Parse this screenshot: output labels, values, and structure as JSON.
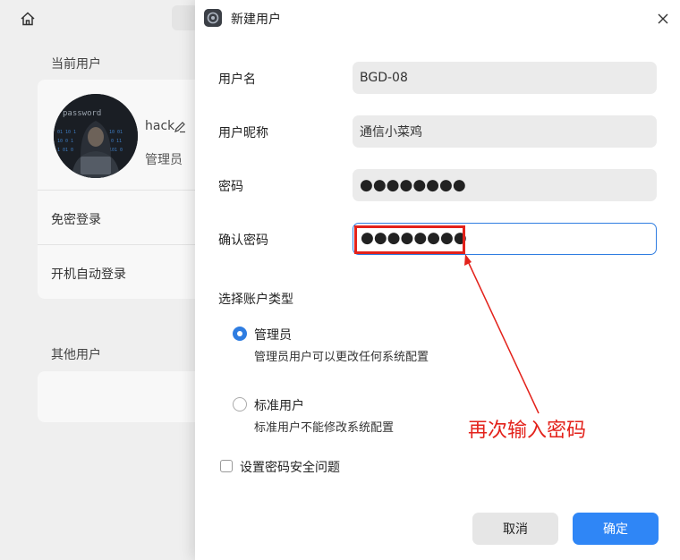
{
  "background": {
    "current_users_label": "当前用户",
    "user": {
      "name": "hack",
      "role": "管理员"
    },
    "rows": [
      "免密登录",
      "开机自动登录"
    ],
    "other_users_label": "其他用户"
  },
  "dialog": {
    "title": "新建用户",
    "fields": [
      {
        "label": "用户名",
        "value": "BGD-08"
      },
      {
        "label": "用户昵称",
        "value": "通信小菜鸡"
      },
      {
        "label": "密码",
        "value": "●●●●●●●●"
      },
      {
        "label": "确认密码",
        "value": "●●●●●●●●"
      }
    ],
    "account_type_title": "选择账户类型",
    "account_types": [
      {
        "title": "管理员",
        "desc": "管理员用户可以更改任何系统配置",
        "selected": true
      },
      {
        "title": "标准用户",
        "desc": "标准用户不能修改系统配置",
        "selected": false
      }
    ],
    "security_question_label": "设置密码安全问题",
    "security_question_checked": false,
    "cancel_label": "取消",
    "ok_label": "确定"
  },
  "annotation": {
    "text": "再次输入密码",
    "color": "#e3221b"
  },
  "colors": {
    "accent": "#2f7de1",
    "ok_button": "#2f86f6"
  }
}
